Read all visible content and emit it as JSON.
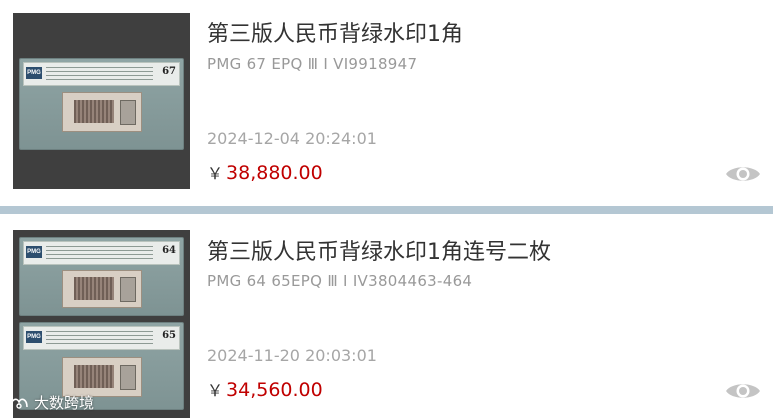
{
  "listings": [
    {
      "title": "第三版人民币背绿水印1角",
      "subtitle": "PMG 67 EPQ Ⅲ Ⅰ VI9918947",
      "date": "2024-12-04 20:24:01",
      "currency": "￥",
      "price": "38,880.00",
      "slab_grades": [
        "67"
      ]
    },
    {
      "title": "第三版人民币背绿水印1角连号二枚",
      "subtitle": "PMG 64 65EPQ Ⅲ Ⅰ IV3804463-464",
      "date": "2024-11-20 20:03:01",
      "currency": "￥",
      "price": "34,560.00",
      "slab_grades": [
        "64",
        "65"
      ]
    }
  ],
  "slab_logo": "PMG",
  "watermark": "大数跨境",
  "colors": {
    "price": "#c00000",
    "divider": "#b4c7d3",
    "title": "#333333",
    "meta": "#999999",
    "eye_icon": "#b5b5b5"
  },
  "icons": [
    "eye-icon",
    "watermark-logo-icon"
  ]
}
